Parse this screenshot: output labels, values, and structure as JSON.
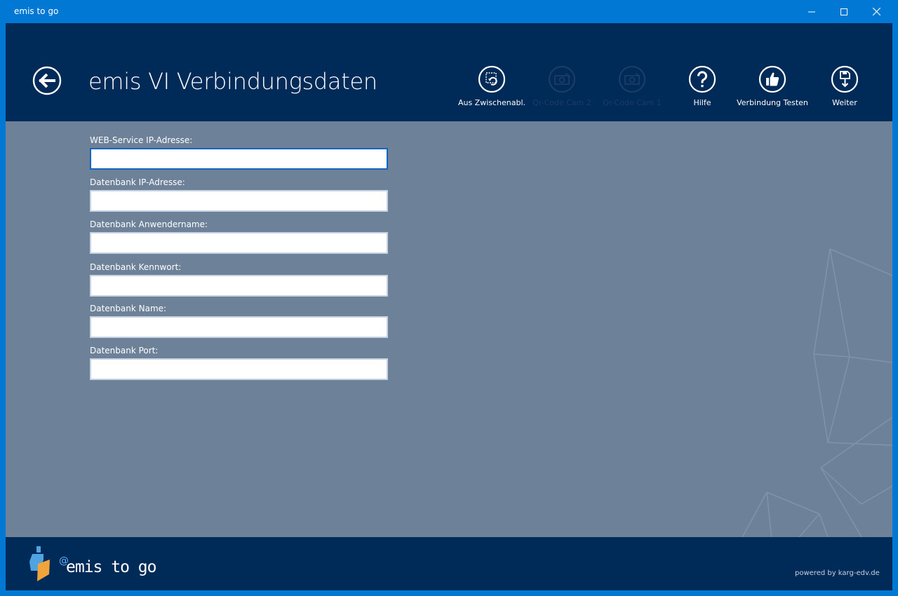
{
  "window": {
    "title": "emis to go"
  },
  "header": {
    "title": "emis VI Verbindungsdaten",
    "buttons": [
      {
        "label": "Aus Zwischenabl.",
        "icon": "clipboard-refresh-icon",
        "enabled": true
      },
      {
        "label": "Qr-Code Cam 2",
        "icon": "camera-switch-icon",
        "enabled": false
      },
      {
        "label": "Qr-Code Cam 1",
        "icon": "camera-switch-icon",
        "enabled": false
      },
      {
        "label": "Hilfe",
        "icon": "help-icon",
        "enabled": true
      },
      {
        "label": "Verbindung Testen",
        "icon": "thumbs-up-icon",
        "enabled": true
      },
      {
        "label": "Weiter",
        "icon": "save-icon",
        "enabled": true
      }
    ]
  },
  "form": {
    "fields": [
      {
        "label": "WEB-Service IP-Adresse:",
        "value": ""
      },
      {
        "label": "Datenbank IP-Adresse:",
        "value": ""
      },
      {
        "label": "Datenbank Anwendername:",
        "value": ""
      },
      {
        "label": "Datenbank Kennwort:",
        "value": ""
      },
      {
        "label": "Datenbank Name:",
        "value": ""
      },
      {
        "label": "Datenbank Port:",
        "value": ""
      }
    ]
  },
  "footer": {
    "logo_at": "@",
    "logo_text": "emis to go",
    "powered_by": "powered by karg-edv.de"
  },
  "colors": {
    "titlebar": "#0078d4",
    "header": "#002a57",
    "content": "#6d8199",
    "disabled_label": "#1b3d68"
  }
}
